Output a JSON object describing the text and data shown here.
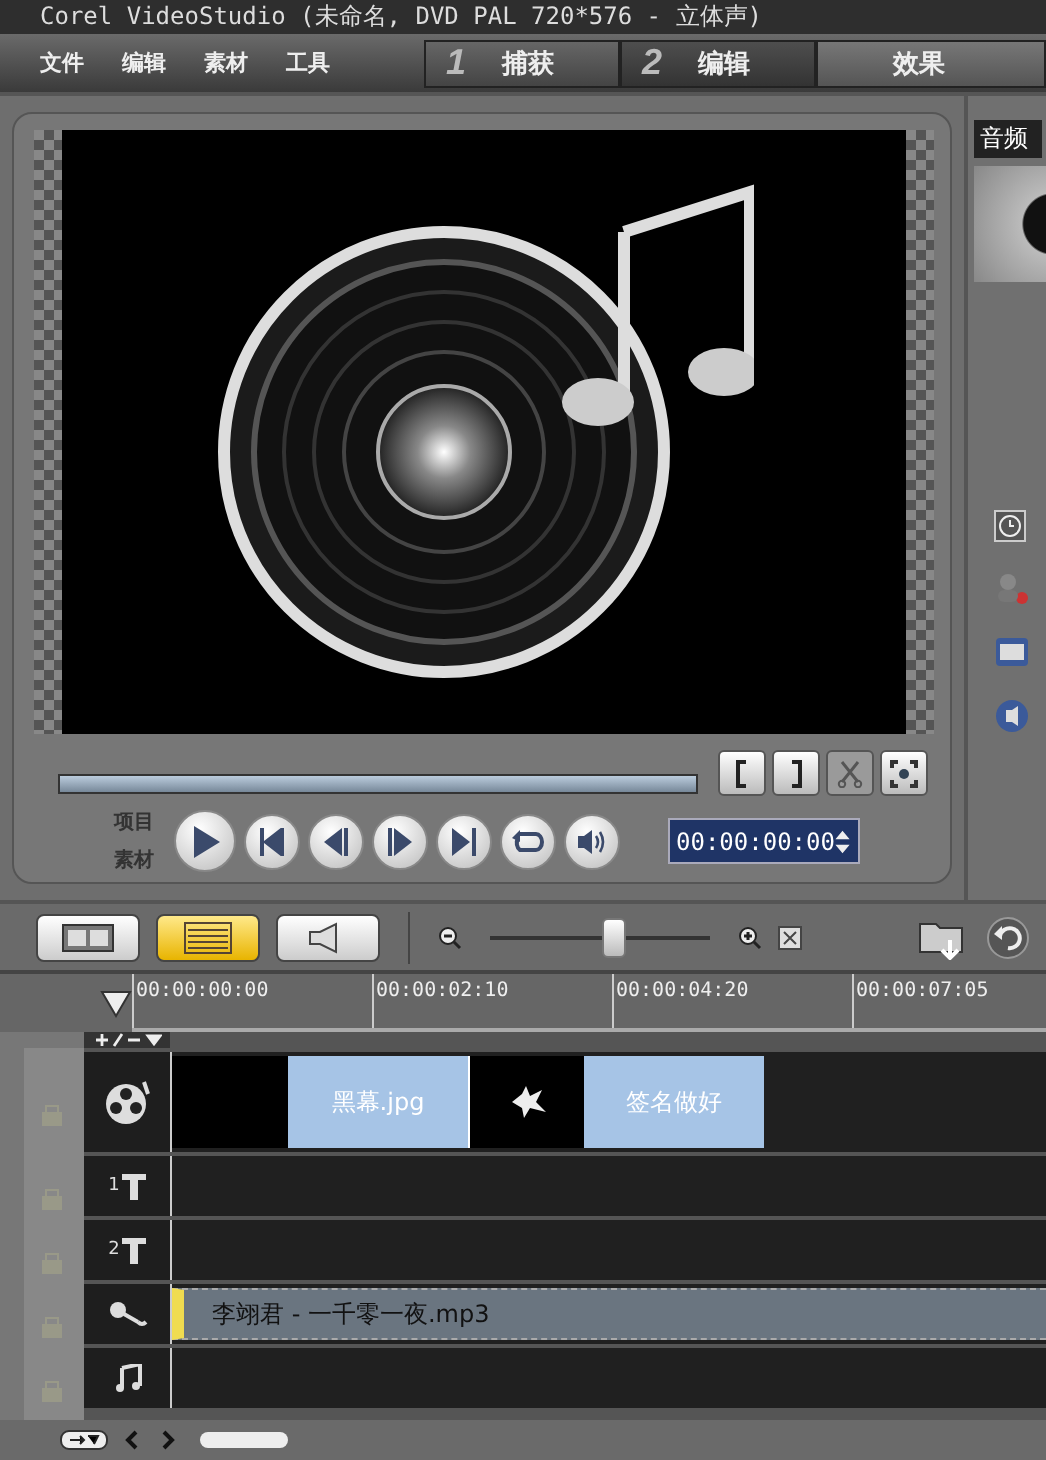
{
  "window": {
    "title": "Corel VideoStudio (未命名, DVD PAL 720*576 - 立体声)"
  },
  "menu": [
    "文件",
    "编辑",
    "素材",
    "工具"
  ],
  "steps": [
    {
      "number": "1",
      "label": "捕获",
      "selected": false
    },
    {
      "number": "2",
      "label": "编辑",
      "selected": true
    },
    {
      "label": "效果",
      "selected": false
    }
  ],
  "player": {
    "mode_labels": [
      "项目",
      "素材"
    ],
    "timecode": "00:00:00:00"
  },
  "library": {
    "title": "音频"
  },
  "toolbar": {
    "views": [
      {
        "kind": "storyboard",
        "selected": false
      },
      {
        "kind": "timeline",
        "selected": true
      },
      {
        "kind": "audio",
        "selected": false
      }
    ],
    "zoom": {
      "level": 0.55
    }
  },
  "timeline": {
    "ruler": [
      "00:00:00:00",
      "00:00:02:10",
      "00:00:04:20",
      "00:00:07:05"
    ],
    "tracks": [
      {
        "kind": "video",
        "clips": [
          {
            "kind": "color"
          },
          {
            "kind": "image",
            "name": "黑幕.jpg"
          },
          {
            "kind": "effect"
          },
          {
            "kind": "image",
            "name": "签名做好"
          }
        ]
      },
      {
        "kind": "title",
        "number": "1"
      },
      {
        "kind": "title",
        "number": "2"
      },
      {
        "kind": "voice",
        "clips": [
          {
            "kind": "audio",
            "name": "李翊君 - 一千零一夜.mp3"
          }
        ]
      },
      {
        "kind": "music"
      }
    ]
  }
}
